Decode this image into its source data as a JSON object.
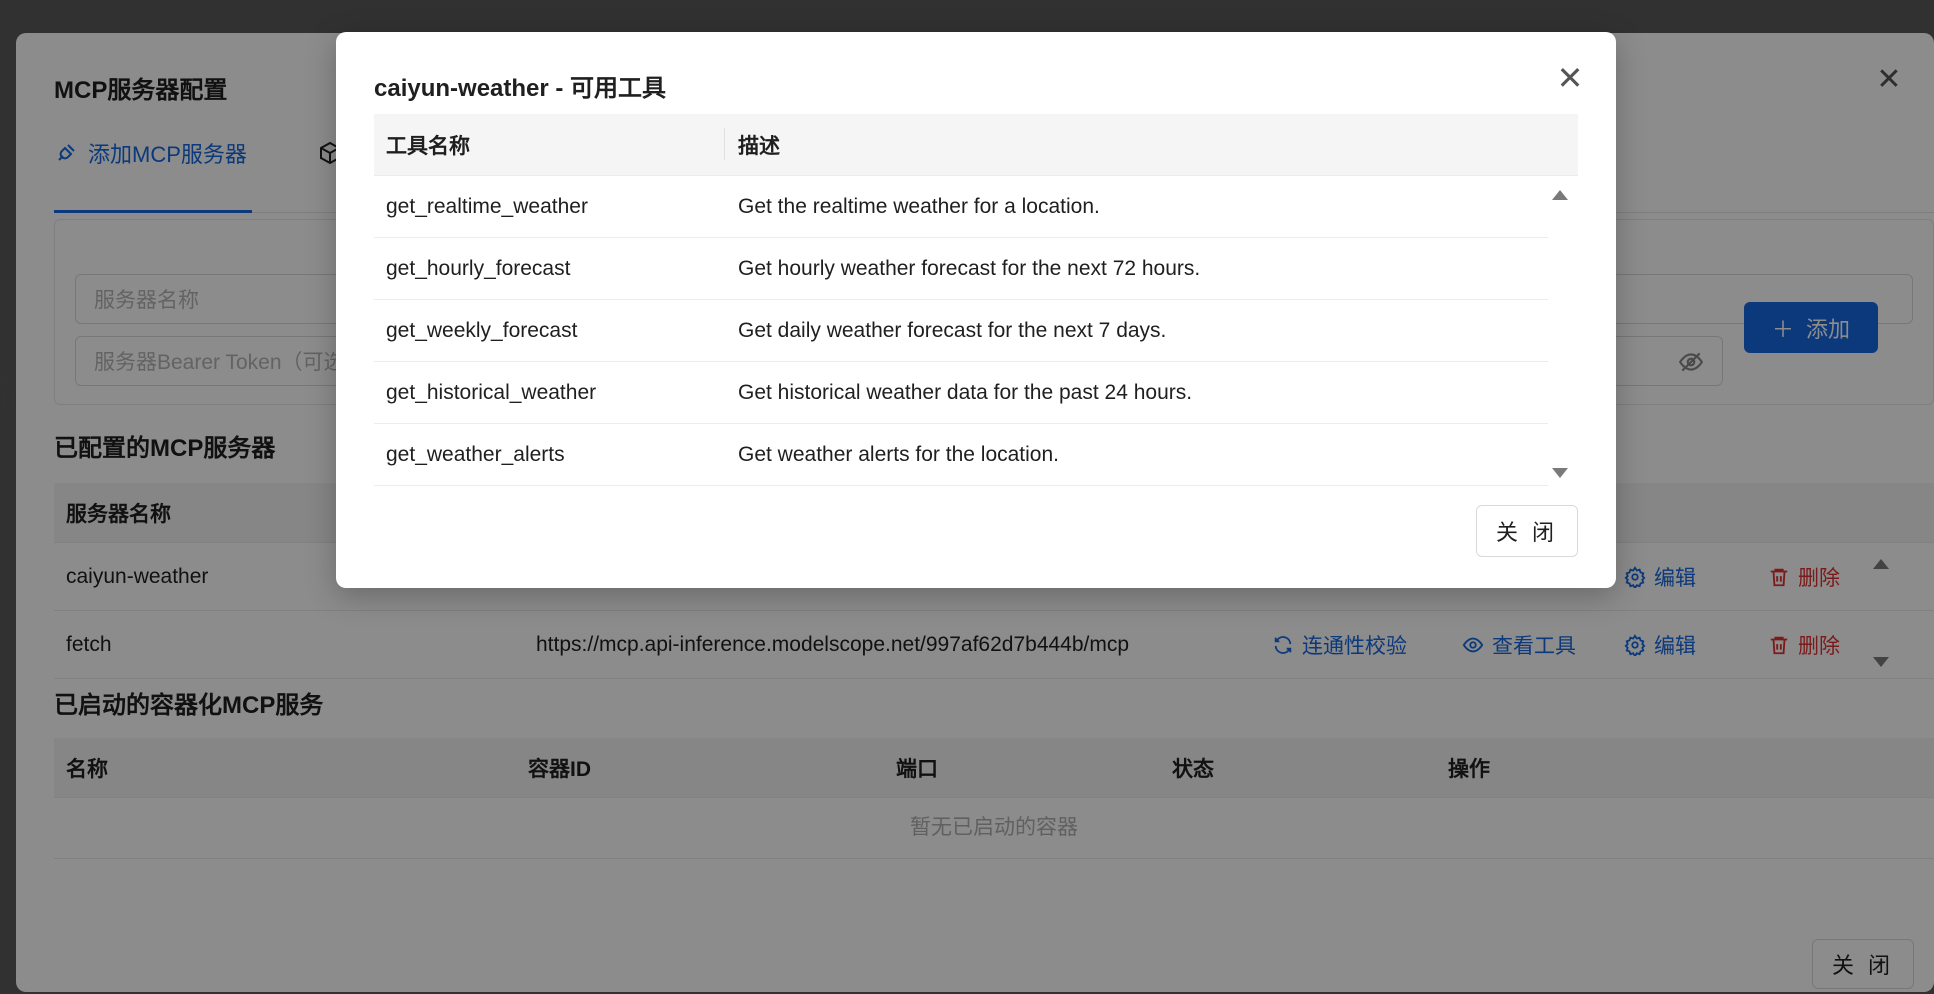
{
  "back_dialog": {
    "title": "MCP服务器配置",
    "tabs": [
      {
        "label": "添加MCP服务器",
        "icon": "plug-icon",
        "active": true
      },
      {
        "label": "",
        "icon": "cube-icon",
        "active": false
      }
    ],
    "form": {
      "server_name_placeholder": "服务器名称",
      "token_placeholder": "服务器Bearer Token（可选",
      "add_button": "添加"
    },
    "configured": {
      "title": "已配置的MCP服务器",
      "columns": [
        "服务器名称"
      ],
      "rows": [
        {
          "name": "caiyun-weather",
          "url": "",
          "edit": "编辑",
          "delete": "删除"
        },
        {
          "name": "fetch",
          "url": "https://mcp.api-inference.modelscope.net/997af62d7b444b/mcp",
          "check": "连通性校验",
          "view": "查看工具",
          "edit": "编辑",
          "delete": "删除"
        }
      ]
    },
    "containers": {
      "title": "已启动的容器化MCP服务",
      "columns": [
        "名称",
        "容器ID",
        "端口",
        "状态",
        "操作"
      ],
      "empty_text": "暂无已启动的容器"
    },
    "close_button": "关 闭"
  },
  "modal": {
    "title": "caiyun-weather - 可用工具",
    "columns": [
      "工具名称",
      "描述"
    ],
    "tools": [
      {
        "name": "get_realtime_weather",
        "description": "Get the realtime weather for a location."
      },
      {
        "name": "get_hourly_forecast",
        "description": "Get hourly weather forecast for the next 72 hours."
      },
      {
        "name": "get_weekly_forecast",
        "description": "Get daily weather forecast for the next 7 days."
      },
      {
        "name": "get_historical_weather",
        "description": "Get historical weather data for the past 24 hours."
      },
      {
        "name": "get_weather_alerts",
        "description": "Get weather alerts for the location."
      }
    ],
    "close_button": "关 闭"
  },
  "colors": {
    "accent": "#1769e0",
    "danger": "#e03030",
    "overlay": "rgba(0,0,0,0.45)"
  }
}
